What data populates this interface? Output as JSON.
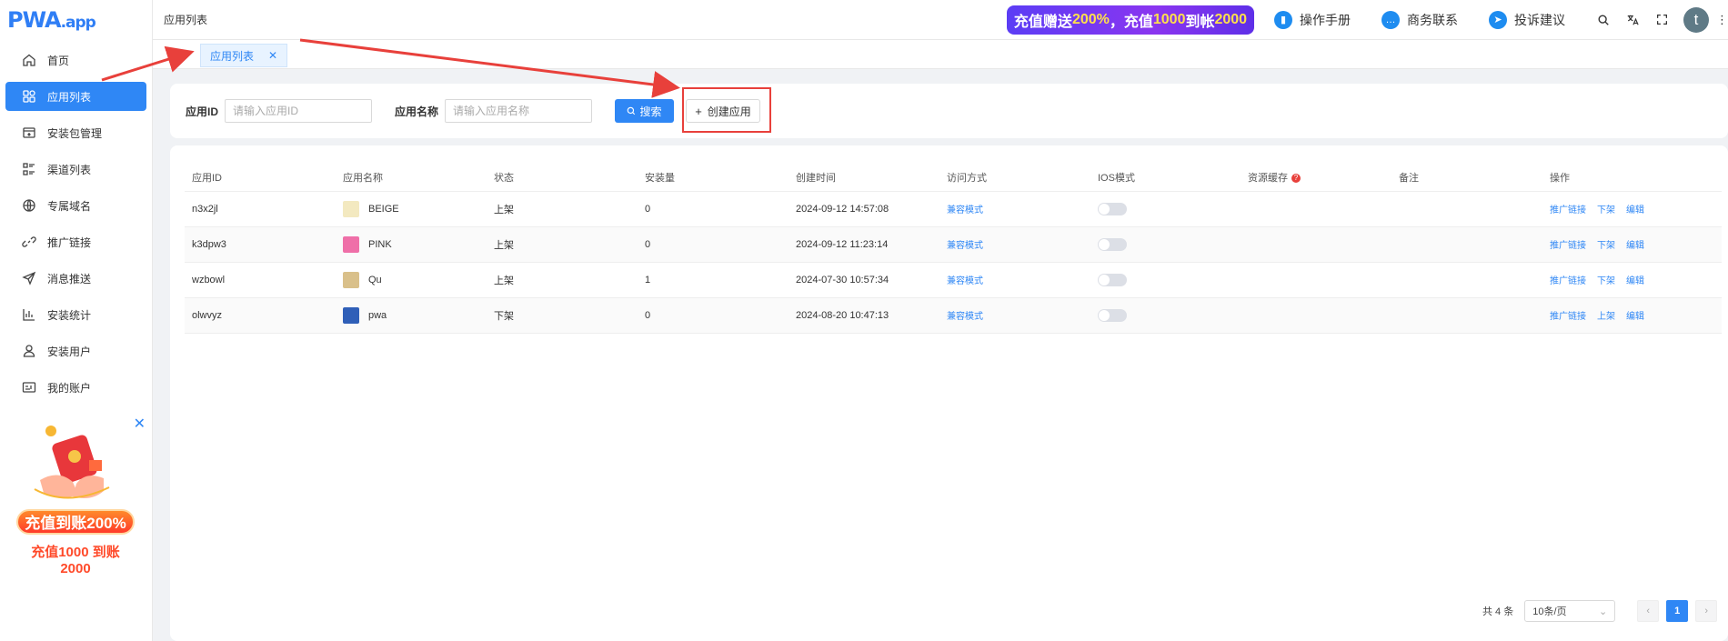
{
  "logo": {
    "main": "PWA",
    "suffix": ".app"
  },
  "sidebar": {
    "items": [
      {
        "label": "首页",
        "icon": "home-icon"
      },
      {
        "label": "应用列表",
        "icon": "grid-icon",
        "active": true
      },
      {
        "label": "安装包管理",
        "icon": "package-icon"
      },
      {
        "label": "渠道列表",
        "icon": "list-icon"
      },
      {
        "label": "专属域名",
        "icon": "globe-icon"
      },
      {
        "label": "推广链接",
        "icon": "link-icon"
      },
      {
        "label": "消息推送",
        "icon": "send-icon"
      },
      {
        "label": "安装统计",
        "icon": "bar-chart-icon"
      },
      {
        "label": "安装用户",
        "icon": "user-icon"
      },
      {
        "label": "我的账户",
        "icon": "account-card-icon"
      }
    ],
    "promo": {
      "line1": "充值到账200%",
      "line2": "充值1000 到账2000"
    }
  },
  "header": {
    "breadcrumb": "应用列表",
    "banner": {
      "part1": "充值赠送",
      "hl1": "200%",
      "part2": "，充值",
      "hl2": "1000",
      "part3": "到帐",
      "hl3": "2000"
    },
    "manual": "操作手册",
    "business": "商务联系",
    "feedback": "投诉建议",
    "avatar": "t"
  },
  "tabs": {
    "active": "应用列表"
  },
  "search": {
    "id_label": "应用ID",
    "id_placeholder": "请输入应用ID",
    "name_label": "应用名称",
    "name_placeholder": "请输入应用名称",
    "search_button": "搜索",
    "create_button": "创建应用"
  },
  "table": {
    "headers": [
      "应用ID",
      "应用名称",
      "状态",
      "安装量",
      "创建时间",
      "访问方式",
      "IOS模式",
      "资源缓存",
      "备注",
      "操作"
    ],
    "rows": [
      {
        "id": "n3x2jl",
        "name": "BEIGE",
        "status": "上架",
        "installs": "0",
        "created": "2024-09-12 14:57:08",
        "access": "兼容模式",
        "action1": "推广链接",
        "action2": "下架",
        "action3": "编辑",
        "icon_color": "#f3e9c0"
      },
      {
        "id": "k3dpw3",
        "name": "PINK",
        "status": "上架",
        "installs": "0",
        "created": "2024-09-12 11:23:14",
        "access": "兼容模式",
        "action1": "推广链接",
        "action2": "下架",
        "action3": "编辑",
        "icon_color": "#ef6fa8"
      },
      {
        "id": "wzbowl",
        "name": "Qu",
        "status": "上架",
        "installs": "1",
        "created": "2024-07-30 10:57:34",
        "access": "兼容模式",
        "action1": "推广链接",
        "action2": "下架",
        "action3": "编辑",
        "icon_color": "#d9c08a"
      },
      {
        "id": "olwvyz",
        "name": "pwa",
        "status": "下架",
        "installs": "0",
        "created": "2024-08-20 10:47:13",
        "access": "兼容模式",
        "action1": "推广链接",
        "action2": "上架",
        "action3": "编辑",
        "icon_color": "#2f5fb8"
      }
    ]
  },
  "pagination": {
    "total": "共 4 条",
    "page_size": "10条/页",
    "current": "1"
  },
  "colors": {
    "primary": "#2f87f5",
    "annotation": "#e8403b"
  }
}
